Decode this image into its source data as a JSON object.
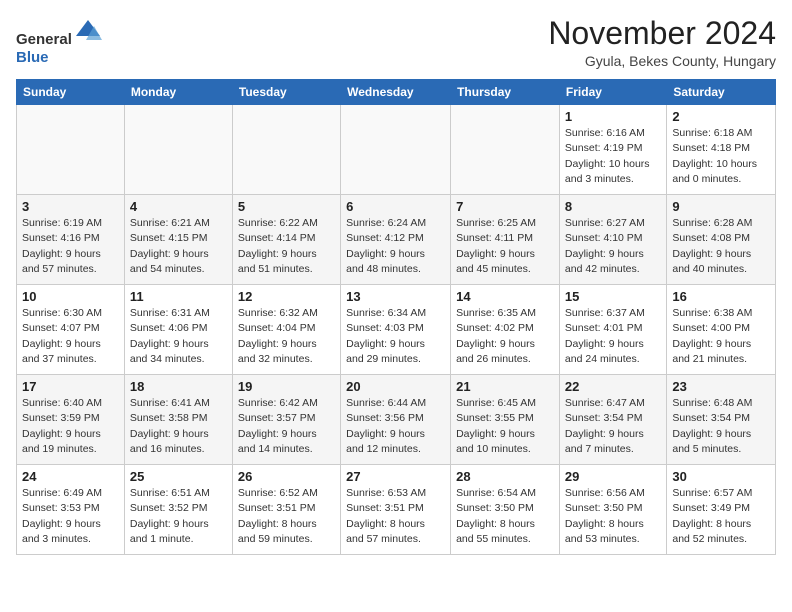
{
  "header": {
    "logo_line1": "General",
    "logo_line2": "Blue",
    "month_title": "November 2024",
    "location": "Gyula, Bekes County, Hungary"
  },
  "days_of_week": [
    "Sunday",
    "Monday",
    "Tuesday",
    "Wednesday",
    "Thursday",
    "Friday",
    "Saturday"
  ],
  "weeks": [
    [
      {
        "day": "",
        "info": ""
      },
      {
        "day": "",
        "info": ""
      },
      {
        "day": "",
        "info": ""
      },
      {
        "day": "",
        "info": ""
      },
      {
        "day": "",
        "info": ""
      },
      {
        "day": "1",
        "info": "Sunrise: 6:16 AM\nSunset: 4:19 PM\nDaylight: 10 hours\nand 3 minutes."
      },
      {
        "day": "2",
        "info": "Sunrise: 6:18 AM\nSunset: 4:18 PM\nDaylight: 10 hours\nand 0 minutes."
      }
    ],
    [
      {
        "day": "3",
        "info": "Sunrise: 6:19 AM\nSunset: 4:16 PM\nDaylight: 9 hours\nand 57 minutes."
      },
      {
        "day": "4",
        "info": "Sunrise: 6:21 AM\nSunset: 4:15 PM\nDaylight: 9 hours\nand 54 minutes."
      },
      {
        "day": "5",
        "info": "Sunrise: 6:22 AM\nSunset: 4:14 PM\nDaylight: 9 hours\nand 51 minutes."
      },
      {
        "day": "6",
        "info": "Sunrise: 6:24 AM\nSunset: 4:12 PM\nDaylight: 9 hours\nand 48 minutes."
      },
      {
        "day": "7",
        "info": "Sunrise: 6:25 AM\nSunset: 4:11 PM\nDaylight: 9 hours\nand 45 minutes."
      },
      {
        "day": "8",
        "info": "Sunrise: 6:27 AM\nSunset: 4:10 PM\nDaylight: 9 hours\nand 42 minutes."
      },
      {
        "day": "9",
        "info": "Sunrise: 6:28 AM\nSunset: 4:08 PM\nDaylight: 9 hours\nand 40 minutes."
      }
    ],
    [
      {
        "day": "10",
        "info": "Sunrise: 6:30 AM\nSunset: 4:07 PM\nDaylight: 9 hours\nand 37 minutes."
      },
      {
        "day": "11",
        "info": "Sunrise: 6:31 AM\nSunset: 4:06 PM\nDaylight: 9 hours\nand 34 minutes."
      },
      {
        "day": "12",
        "info": "Sunrise: 6:32 AM\nSunset: 4:04 PM\nDaylight: 9 hours\nand 32 minutes."
      },
      {
        "day": "13",
        "info": "Sunrise: 6:34 AM\nSunset: 4:03 PM\nDaylight: 9 hours\nand 29 minutes."
      },
      {
        "day": "14",
        "info": "Sunrise: 6:35 AM\nSunset: 4:02 PM\nDaylight: 9 hours\nand 26 minutes."
      },
      {
        "day": "15",
        "info": "Sunrise: 6:37 AM\nSunset: 4:01 PM\nDaylight: 9 hours\nand 24 minutes."
      },
      {
        "day": "16",
        "info": "Sunrise: 6:38 AM\nSunset: 4:00 PM\nDaylight: 9 hours\nand 21 minutes."
      }
    ],
    [
      {
        "day": "17",
        "info": "Sunrise: 6:40 AM\nSunset: 3:59 PM\nDaylight: 9 hours\nand 19 minutes."
      },
      {
        "day": "18",
        "info": "Sunrise: 6:41 AM\nSunset: 3:58 PM\nDaylight: 9 hours\nand 16 minutes."
      },
      {
        "day": "19",
        "info": "Sunrise: 6:42 AM\nSunset: 3:57 PM\nDaylight: 9 hours\nand 14 minutes."
      },
      {
        "day": "20",
        "info": "Sunrise: 6:44 AM\nSunset: 3:56 PM\nDaylight: 9 hours\nand 12 minutes."
      },
      {
        "day": "21",
        "info": "Sunrise: 6:45 AM\nSunset: 3:55 PM\nDaylight: 9 hours\nand 10 minutes."
      },
      {
        "day": "22",
        "info": "Sunrise: 6:47 AM\nSunset: 3:54 PM\nDaylight: 9 hours\nand 7 minutes."
      },
      {
        "day": "23",
        "info": "Sunrise: 6:48 AM\nSunset: 3:54 PM\nDaylight: 9 hours\nand 5 minutes."
      }
    ],
    [
      {
        "day": "24",
        "info": "Sunrise: 6:49 AM\nSunset: 3:53 PM\nDaylight: 9 hours\nand 3 minutes."
      },
      {
        "day": "25",
        "info": "Sunrise: 6:51 AM\nSunset: 3:52 PM\nDaylight: 9 hours\nand 1 minute."
      },
      {
        "day": "26",
        "info": "Sunrise: 6:52 AM\nSunset: 3:51 PM\nDaylight: 8 hours\nand 59 minutes."
      },
      {
        "day": "27",
        "info": "Sunrise: 6:53 AM\nSunset: 3:51 PM\nDaylight: 8 hours\nand 57 minutes."
      },
      {
        "day": "28",
        "info": "Sunrise: 6:54 AM\nSunset: 3:50 PM\nDaylight: 8 hours\nand 55 minutes."
      },
      {
        "day": "29",
        "info": "Sunrise: 6:56 AM\nSunset: 3:50 PM\nDaylight: 8 hours\nand 53 minutes."
      },
      {
        "day": "30",
        "info": "Sunrise: 6:57 AM\nSunset: 3:49 PM\nDaylight: 8 hours\nand 52 minutes."
      }
    ]
  ]
}
